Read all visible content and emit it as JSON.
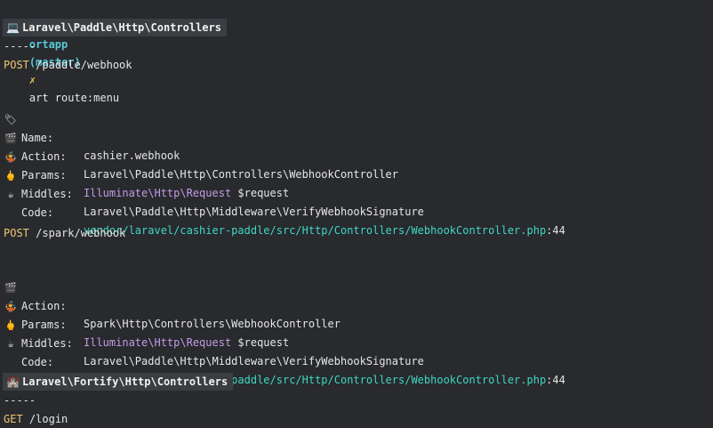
{
  "prompt": {
    "arrow": "➜",
    "cwd": "ortapp",
    "branch": "(master)",
    "dirty": "✗",
    "command": "art route:menu"
  },
  "groups": [
    {
      "emoji": "💻",
      "title": "Laravel\\Paddle\\Http\\Controllers",
      "dashes": "-----",
      "routes": [
        {
          "method": "POST",
          "path": "/paddle/webhook",
          "name": "cashier.webhook",
          "action": "Laravel\\Paddle\\Http\\Controllers\\WebhookController",
          "params_type": "Illuminate\\Http\\Request",
          "params_var": "$request",
          "middles": "Laravel\\Paddle\\Http\\Middleware\\VerifyWebhookSignature",
          "code_path": "vendor/laravel/cashier-paddle/src/Http/Controllers/WebhookController.php",
          "code_line": ":44"
        },
        {
          "method": "POST",
          "path": "/spark/webhook",
          "action": "Spark\\Http\\Controllers\\WebhookController",
          "params_type": "Illuminate\\Http\\Request",
          "params_var": "$request",
          "middles": "Laravel\\Paddle\\Http\\Middleware\\VerifyWebhookSignature",
          "code_path": "vendor/laravel/cashier-paddle/src/Http/Controllers/WebhookController.php",
          "code_line": ":44"
        }
      ]
    },
    {
      "emoji": "🏰",
      "title": "Laravel\\Fortify\\Http\\Controllers",
      "dashes": "-----",
      "routes": [
        {
          "method": "GET",
          "path": "/login"
        }
      ]
    }
  ],
  "labels": {
    "name": "Name:",
    "action": "Action:",
    "params": "Params:",
    "middles": "Middles:",
    "code": "Code:"
  },
  "icons": {
    "name": "🏷",
    "action": "🎬",
    "params": "🤹",
    "middles": "🖕",
    "code": "☕"
  }
}
